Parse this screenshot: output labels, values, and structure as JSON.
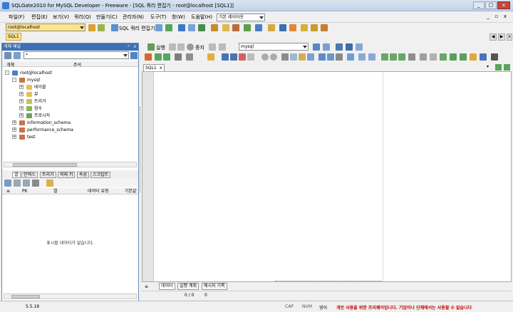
{
  "window": {
    "title": "SQLGate2010 for MySQL Developer - Freeware - [SQL 쿼리 편집기 - root@localhost [SQL1]]"
  },
  "menu": {
    "items": [
      "파일(F)",
      "편집(E)",
      "보기(V)",
      "쿼리(Q)",
      "만들기(C)",
      "관리자(N)",
      "도구(T)",
      "창(W)",
      "도움말(H)"
    ],
    "layout_combo": "기본 레이아웃"
  },
  "toolbar": {
    "connection": "root@localhost",
    "query_editor_label": "SQL 쿼리 편집기"
  },
  "doc_tabs": {
    "active": "SQL1"
  },
  "object_panel": {
    "title": "개체 패널",
    "filter_value": "*",
    "columns": {
      "object": "개체",
      "comment": "주석"
    },
    "tree": {
      "root": "root@localhost",
      "db_mysql": "mysql",
      "children": [
        "테이블",
        "뷰",
        "트리거",
        "함수",
        "프로시저"
      ],
      "other_dbs": [
        "information_schema",
        "performance_schema",
        "test"
      ]
    }
  },
  "props": {
    "tabs": [
      "열",
      "인덱스",
      "트리거",
      "외래 키",
      "속성",
      "스크립트"
    ],
    "grid_headers": {
      "pk": "PK",
      "column": "열",
      "type": "데이터 유형",
      "default": "기본값"
    },
    "empty_message": "표시할 데이터가 없습니다."
  },
  "editor": {
    "run_label": "실행",
    "stop_label": "중지",
    "db_combo": "mysql",
    "tab_label": "SQL1"
  },
  "results": {
    "tabs": [
      "데이터",
      "실행 계획",
      "메시지 기록"
    ],
    "counter": "0 / 0",
    "side_counter": "0"
  },
  "status": {
    "version": "5.5.18",
    "cap": "CAP",
    "num": "NUM",
    "lang": "영어",
    "notice": "개인 사용을 위한 프리웨어입니다. 기업이나 단체에서는 사용할 수 없습니다"
  }
}
